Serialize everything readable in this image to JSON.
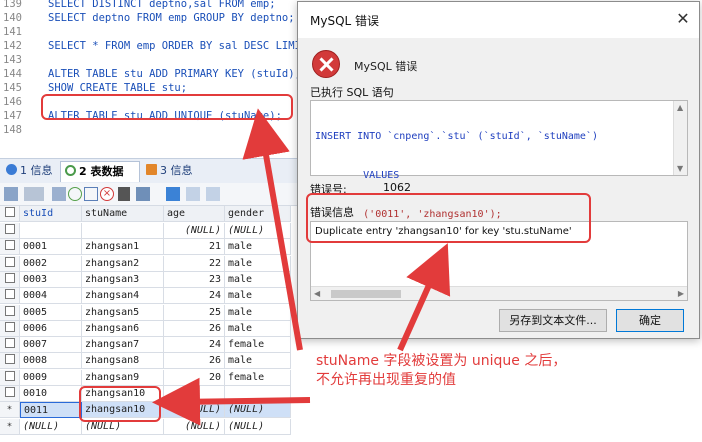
{
  "editor": {
    "lines": [
      {
        "n": "139",
        "code": "SELECT DISTINCT deptno,sal FROM emp;"
      },
      {
        "n": "140",
        "code": "SELECT deptno FROM emp GROUP BY deptno;"
      },
      {
        "n": "141",
        "code": ""
      },
      {
        "n": "142",
        "code": "SELECT * FROM emp ORDER BY sal DESC LIMIT"
      },
      {
        "n": "143",
        "code": ""
      },
      {
        "n": "144",
        "code": "ALTER TABLE stu ADD PRIMARY KEY (stuId);"
      },
      {
        "n": "145",
        "code": "SHOW CREATE TABLE stu;"
      },
      {
        "n": "146",
        "code": ""
      },
      {
        "n": "147",
        "code": "ALTER TABLE stu ADD UNIQUE (stuName);"
      },
      {
        "n": "148",
        "code": ""
      }
    ]
  },
  "tabs": [
    {
      "num": "1",
      "label": "信息",
      "color": "#3a7bd5"
    },
    {
      "num": "2",
      "label": "表数据",
      "color": "#ffffff"
    },
    {
      "num": "3",
      "label": "信息",
      "color": "#e2862a"
    }
  ],
  "grid": {
    "columns": [
      "stuId",
      "stuName",
      "age",
      "gender"
    ],
    "rows": [
      {
        "marker": "",
        "stuId": "",
        "stuName": "",
        "age": "(NULL)",
        "gender": "(NULL)",
        "selected": false
      },
      {
        "marker": "",
        "stuId": "0001",
        "stuName": "zhangsan1",
        "age": "21",
        "gender": "male",
        "selected": false
      },
      {
        "marker": "",
        "stuId": "0002",
        "stuName": "zhangsan2",
        "age": "22",
        "gender": "male",
        "selected": false
      },
      {
        "marker": "",
        "stuId": "0003",
        "stuName": "zhangsan3",
        "age": "23",
        "gender": "male",
        "selected": false
      },
      {
        "marker": "",
        "stuId": "0004",
        "stuName": "zhangsan4",
        "age": "24",
        "gender": "male",
        "selected": false
      },
      {
        "marker": "",
        "stuId": "0005",
        "stuName": "zhangsan5",
        "age": "25",
        "gender": "male",
        "selected": false
      },
      {
        "marker": "",
        "stuId": "0006",
        "stuName": "zhangsan6",
        "age": "26",
        "gender": "male",
        "selected": false
      },
      {
        "marker": "",
        "stuId": "0007",
        "stuName": "zhangsan7",
        "age": "24",
        "gender": "female",
        "selected": false
      },
      {
        "marker": "",
        "stuId": "0008",
        "stuName": "zhangsan8",
        "age": "26",
        "gender": "male",
        "selected": false
      },
      {
        "marker": "",
        "stuId": "0009",
        "stuName": "zhangsan9",
        "age": "20",
        "gender": "female",
        "selected": false
      },
      {
        "marker": "",
        "stuId": "0010",
        "stuName": "zhangsan10",
        "age": "",
        "gender": "",
        "selected": false
      },
      {
        "marker": "*",
        "stuId": "0011",
        "stuName": "zhangsan10",
        "age": "(NULL)",
        "gender": "(NULL)",
        "selected": true
      },
      {
        "marker": "*",
        "stuId": "(NULL)",
        "stuName": "(NULL)",
        "age": "(NULL)",
        "gender": "(NULL)",
        "selected": false
      }
    ]
  },
  "dialog": {
    "title": "MySQL 错误",
    "close_glyph": "✕",
    "header": "MySQL 错误",
    "executed_label": "已执行 SQL 语句",
    "sql_lines": [
      "INSERT INTO `cnpeng`.`stu` (`stuId`, `stuName`)",
      "        VALUES",
      "        ('0011', 'zhangsan10');"
    ],
    "errno_label": "错误号:",
    "errno_value": "1062",
    "errinfo_label": "错误信息",
    "errinfo_text": "Duplicate entry 'zhangsan10' for key 'stu.stuName'",
    "save_button": "另存到文本文件...",
    "ok_button": "确定"
  },
  "annotation": "stuName 字段被设置为 unique 之后，\n不允许再出现重复的值",
  "colors": {
    "accent_red": "#e23b3b",
    "sql_keyword": "#1a4fb8"
  }
}
